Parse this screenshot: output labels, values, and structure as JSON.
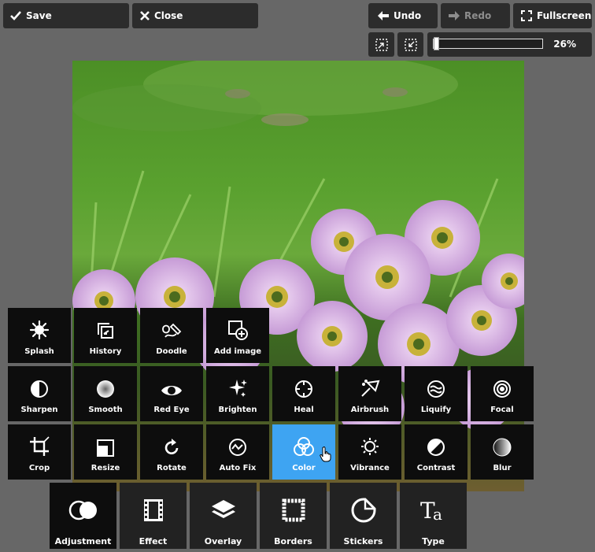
{
  "top_left": {
    "save_label": "Save",
    "close_label": "Close"
  },
  "top_right": {
    "undo_label": "Undo",
    "redo_label": "Redo",
    "fullscreen_label": "Fullscreen"
  },
  "zoom": {
    "percent_label": "26%",
    "value": 0.26
  },
  "tools": [
    {
      "label": "Splash",
      "icon": "splash-icon"
    },
    {
      "label": "History",
      "icon": "history-icon"
    },
    {
      "label": "Doodle",
      "icon": "doodle-icon"
    },
    {
      "label": "Add image",
      "icon": "add-image-icon"
    },
    {
      "label": "Sharpen",
      "icon": "sharpen-icon"
    },
    {
      "label": "Smooth",
      "icon": "smooth-icon"
    },
    {
      "label": "Red Eye",
      "icon": "red-eye-icon"
    },
    {
      "label": "Brighten",
      "icon": "brighten-icon"
    },
    {
      "label": "Heal",
      "icon": "heal-icon"
    },
    {
      "label": "Airbrush",
      "icon": "airbrush-icon"
    },
    {
      "label": "Liquify",
      "icon": "liquify-icon"
    },
    {
      "label": "Focal",
      "icon": "focal-icon"
    },
    {
      "label": "Crop",
      "icon": "crop-icon"
    },
    {
      "label": "Resize",
      "icon": "resize-icon"
    },
    {
      "label": "Rotate",
      "icon": "rotate-icon"
    },
    {
      "label": "Auto Fix",
      "icon": "auto-fix-icon"
    },
    {
      "label": "Color",
      "icon": "color-icon",
      "active": true
    },
    {
      "label": "Vibrance",
      "icon": "vibrance-icon"
    },
    {
      "label": "Contrast",
      "icon": "contrast-icon"
    },
    {
      "label": "Blur",
      "icon": "blur-icon"
    }
  ],
  "tabs": [
    {
      "label": "Adjustment",
      "icon": "adjustment-icon",
      "active": true
    },
    {
      "label": "Effect",
      "icon": "film-icon"
    },
    {
      "label": "Overlay",
      "icon": "layers-icon"
    },
    {
      "label": "Borders",
      "icon": "frame-icon"
    },
    {
      "label": "Stickers",
      "icon": "sticker-icon"
    },
    {
      "label": "Type",
      "icon": "type-icon"
    }
  ],
  "colors": {
    "active_tool": "#3ea4f2",
    "background": "#676767",
    "button": "#2c2c2c"
  }
}
